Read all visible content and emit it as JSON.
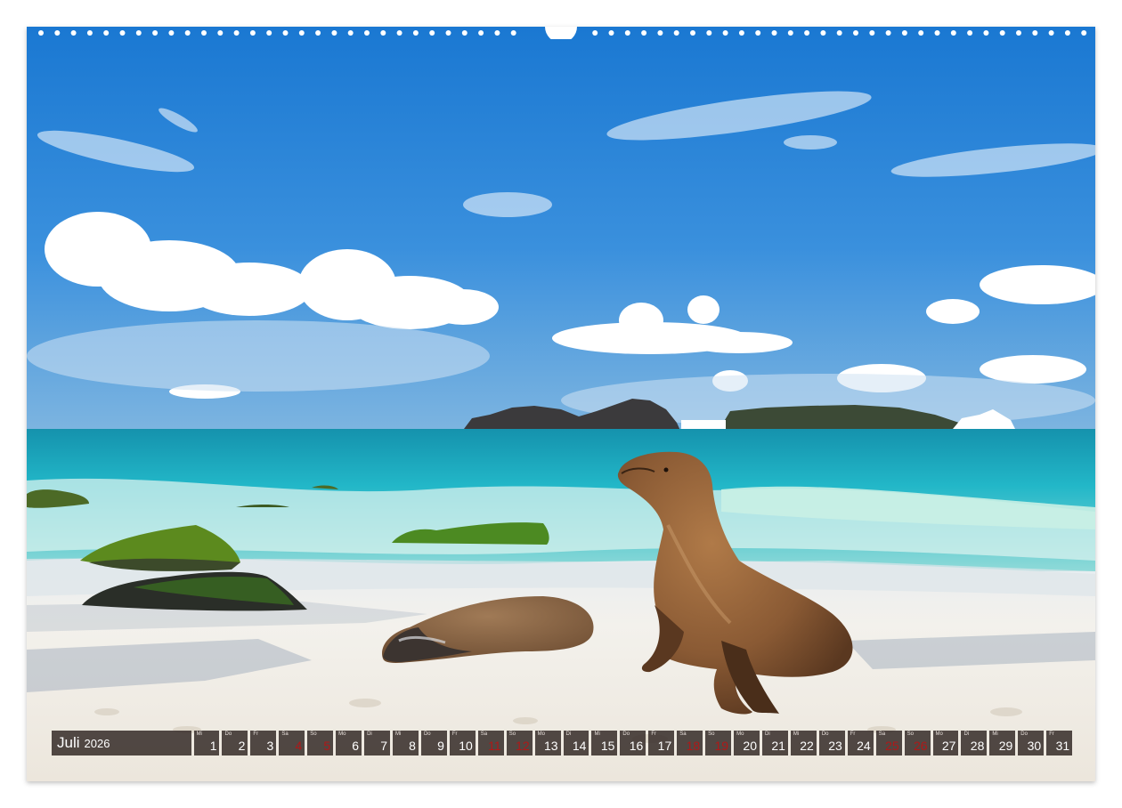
{
  "calendar": {
    "month": "Juli",
    "year": "2026",
    "days": [
      {
        "weekday": "Mi",
        "day": "1",
        "weekend": false
      },
      {
        "weekday": "Do",
        "day": "2",
        "weekend": false
      },
      {
        "weekday": "Fr",
        "day": "3",
        "weekend": false
      },
      {
        "weekday": "Sa",
        "day": "4",
        "weekend": true
      },
      {
        "weekday": "So",
        "day": "5",
        "weekend": true
      },
      {
        "weekday": "Mo",
        "day": "6",
        "weekend": false
      },
      {
        "weekday": "Di",
        "day": "7",
        "weekend": false
      },
      {
        "weekday": "Mi",
        "day": "8",
        "weekend": false
      },
      {
        "weekday": "Do",
        "day": "9",
        "weekend": false
      },
      {
        "weekday": "Fr",
        "day": "10",
        "weekend": false
      },
      {
        "weekday": "Sa",
        "day": "11",
        "weekend": true
      },
      {
        "weekday": "So",
        "day": "12",
        "weekend": true
      },
      {
        "weekday": "Mo",
        "day": "13",
        "weekend": false
      },
      {
        "weekday": "Di",
        "day": "14",
        "weekend": false
      },
      {
        "weekday": "Mi",
        "day": "15",
        "weekend": false
      },
      {
        "weekday": "Do",
        "day": "16",
        "weekend": false
      },
      {
        "weekday": "Fr",
        "day": "17",
        "weekend": false
      },
      {
        "weekday": "Sa",
        "day": "18",
        "weekend": true
      },
      {
        "weekday": "So",
        "day": "19",
        "weekend": true
      },
      {
        "weekday": "Mo",
        "day": "20",
        "weekend": false
      },
      {
        "weekday": "Di",
        "day": "21",
        "weekend": false
      },
      {
        "weekday": "Mi",
        "day": "22",
        "weekend": false
      },
      {
        "weekday": "Do",
        "day": "23",
        "weekend": false
      },
      {
        "weekday": "Fr",
        "day": "24",
        "weekend": false
      },
      {
        "weekday": "Sa",
        "day": "25",
        "weekend": true
      },
      {
        "weekday": "So",
        "day": "26",
        "weekend": true
      },
      {
        "weekday": "Mo",
        "day": "27",
        "weekend": false
      },
      {
        "weekday": "Di",
        "day": "28",
        "weekend": false
      },
      {
        "weekday": "Mi",
        "day": "29",
        "weekend": false
      },
      {
        "weekday": "Do",
        "day": "30",
        "weekend": false
      },
      {
        "weekday": "Fr",
        "day": "31",
        "weekend": false
      }
    ]
  },
  "colors": {
    "sky_top": "#1f7fd6",
    "sky_bottom": "#5aa8e6",
    "sea": "#1fb0c6",
    "sand": "#f2efe8",
    "sea_lion": "#8a5a34",
    "calendar_bar": "#3a302c",
    "weekend_number": "#b01818"
  }
}
